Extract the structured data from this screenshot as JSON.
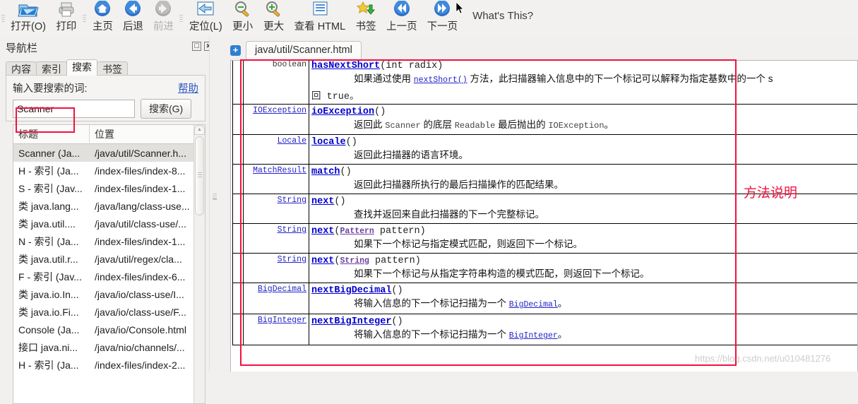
{
  "toolbar": {
    "items": [
      {
        "label": "打开(O)",
        "icon": "open-folder-icon"
      },
      {
        "label": "打印",
        "icon": "printer-icon"
      },
      {
        "label": "主页",
        "icon": "home-icon"
      },
      {
        "label": "后退",
        "icon": "back-arrow-icon"
      },
      {
        "label": "前进",
        "icon": "forward-arrow-icon",
        "disabled": true
      },
      {
        "label": "定位(L)",
        "icon": "locate-icon"
      },
      {
        "label": "更小",
        "icon": "zoom-out-icon"
      },
      {
        "label": "更大",
        "icon": "zoom-in-icon"
      },
      {
        "label": "查看 HTML",
        "icon": "view-html-icon"
      },
      {
        "label": "书签",
        "icon": "bookmark-star-icon"
      },
      {
        "label": "上一页",
        "icon": "prev-page-icon"
      },
      {
        "label": "下一页",
        "icon": "next-page-icon"
      }
    ],
    "whats_this": "What's This?"
  },
  "nav": {
    "title": "导航栏",
    "float_button": "float-icon",
    "close_button": "close-icon",
    "tabs": [
      {
        "label": "内容",
        "active": false
      },
      {
        "label": "索引",
        "active": false
      },
      {
        "label": "搜索",
        "active": true
      },
      {
        "label": "书签",
        "active": false
      }
    ],
    "search": {
      "label": "输入要搜索的词:",
      "help_link": "帮助",
      "input_value": "Scanner",
      "input_placeholder": "",
      "dropdown_icon": "chevron-down-icon",
      "button_label": "搜索(G)"
    },
    "results": {
      "columns": [
        "标题",
        "位置"
      ],
      "rows": [
        {
          "title": "Scanner (Ja...",
          "location": "/java/util/Scanner.h...",
          "selected": true
        },
        {
          "title": "H - 索引 (Ja...",
          "location": "/index-files/index-8...",
          "selected": false
        },
        {
          "title": "S - 索引 (Jav...",
          "location": "/index-files/index-1...",
          "selected": false
        },
        {
          "title": "类 java.lang...",
          "location": "/java/lang/class-use...",
          "selected": false
        },
        {
          "title": "类 java.util....",
          "location": "/java/util/class-use/...",
          "selected": false
        },
        {
          "title": "N - 索引 (Ja...",
          "location": "/index-files/index-1...",
          "selected": false
        },
        {
          "title": "类 java.util.r...",
          "location": "/java/util/regex/cla...",
          "selected": false
        },
        {
          "title": "F - 索引 (Jav...",
          "location": "/index-files/index-6...",
          "selected": false
        },
        {
          "title": "类 java.io.In...",
          "location": "/java/io/class-use/I...",
          "selected": false
        },
        {
          "title": "类 java.io.Fi...",
          "location": "/java/io/class-use/F...",
          "selected": false
        },
        {
          "title": "Console (Ja...",
          "location": "/java/io/Console.html",
          "selected": false
        },
        {
          "title": "接口 java.ni...",
          "location": "/java/nio/channels/...",
          "selected": false
        },
        {
          "title": "H - 索引 (Ja...",
          "location": "/index-files/index-2...",
          "selected": false
        }
      ]
    }
  },
  "doc": {
    "add_tab_icon": "add-tab-icon",
    "tab_label": "java/util/Scanner.html",
    "annotation": "方法说明",
    "watermark": "https://blog.csdn.net/u010481276",
    "methods": [
      {
        "return_type": "boolean",
        "return_type_link": false,
        "name": "hasNextShort",
        "params_pre": "(int radix)",
        "desc_html": "如果通过使用 <a class=\"lnk\" href=\"#\">nextShort()</a> 方法，此扫描器输入信息中的下一个标记可以解释为指定基数中的一个 s",
        "desc_cont": "回 true。"
      },
      {
        "return_type": "IOException",
        "return_type_link": true,
        "name": "ioException",
        "params_pre": "()",
        "desc_html": "返回此 <span class=\"mono\">Scanner</span> 的底层 <span class=\"mono\">Readable</span> 最后抛出的 <span class=\"mono\">IOException</span>。",
        "desc_cont": ""
      },
      {
        "return_type": "Locale",
        "return_type_link": true,
        "name": "locale",
        "params_pre": "()",
        "desc_html": "返回此扫描器的语言环境。",
        "desc_cont": ""
      },
      {
        "return_type": "MatchResult",
        "return_type_link": true,
        "name": "match",
        "params_pre": "()",
        "desc_html": "返回此扫描器所执行的最后扫描操作的匹配结果。",
        "desc_cont": ""
      },
      {
        "return_type": "String",
        "return_type_link": true,
        "name": "next",
        "params_pre": "()",
        "desc_html": "查找并返回来自此扫描器的下一个完整标记。",
        "desc_cont": ""
      },
      {
        "return_type": "String",
        "return_type_link": true,
        "name": "next",
        "params_pre": "(<a class=\"tlnk\" href=\"#\">Pattern</a> pattern)",
        "desc_html": "如果下一个标记与指定模式匹配，则返回下一个标记。",
        "desc_cont": ""
      },
      {
        "return_type": "String",
        "return_type_link": true,
        "name": "next",
        "params_pre": "(<a class=\"tlnk\" href=\"#\">String</a> pattern)",
        "desc_html": "如果下一个标记与从指定字符串构造的模式匹配，则返回下一个标记。",
        "desc_cont": ""
      },
      {
        "return_type": "BigDecimal",
        "return_type_link": true,
        "name": "nextBigDecimal",
        "params_pre": "()",
        "desc_html": "将输入信息的下一个标记扫描为一个 <a class=\"lnk\" href=\"#\">BigDecimal</a>。",
        "desc_cont": ""
      },
      {
        "return_type": "BigInteger",
        "return_type_link": true,
        "name": "nextBigInteger",
        "params_pre": "()",
        "desc_html": "将输入信息的下一个标记扫描为一个 <a class=\"lnk\" href=\"#\">BigInteger</a>。",
        "desc_cont": ""
      }
    ]
  },
  "colors": {
    "annotation_red": "#f2123e",
    "link_blue": "#0000cd",
    "accent_blue": "#2f7fd0"
  }
}
